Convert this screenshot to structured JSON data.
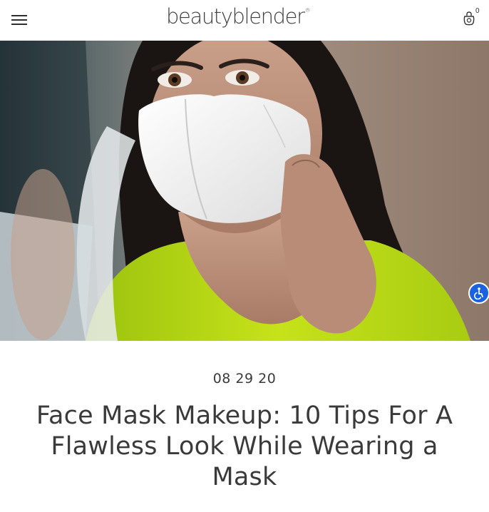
{
  "header": {
    "logo_text": "beautyblender",
    "logo_mark": "®",
    "menu_icon": "hamburger-menu-icon",
    "bag_icon": "shopping-bag-icon",
    "bag_count": "0"
  },
  "hero": {
    "alt_subject": "woman-adjusting-white-face-mask-photo"
  },
  "accessibility": {
    "icon": "accessibility-icon",
    "color": "#1a62e0"
  },
  "article": {
    "date": "08 29 20",
    "title": "Face Mask Makeup: 10 Tips For A Flawless Look While Wearing a Mask"
  }
}
